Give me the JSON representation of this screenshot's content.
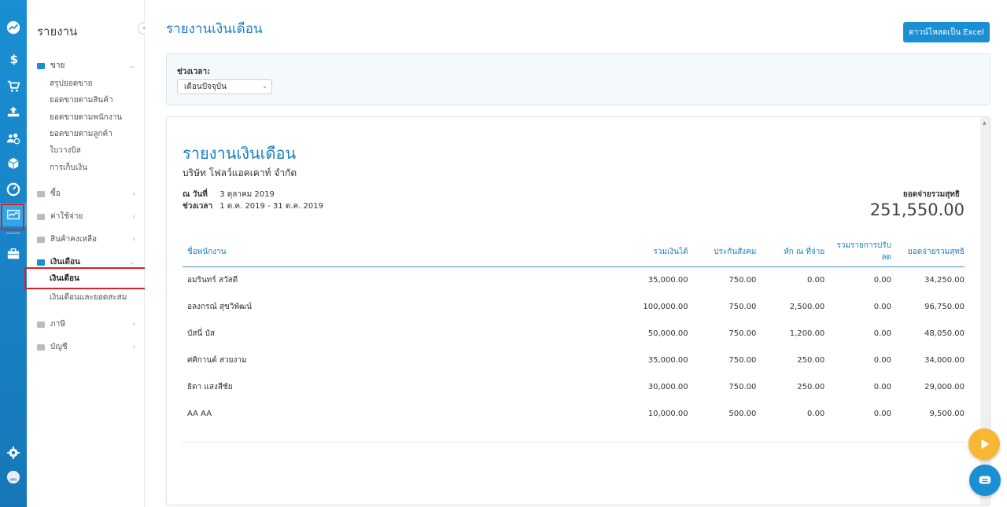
{
  "menu": {
    "title": "รายงาน",
    "groups": [
      {
        "label": "ขาย",
        "open": true,
        "items": [
          "สรุปยอดขาย",
          "ยอดขายตามสินค้า",
          "ยอดขายตามพนักงาน",
          "ยอดขายตามลูกค้า",
          "ใบวางบิล",
          "การเก็บเงิน"
        ]
      },
      {
        "label": "ซื้อ"
      },
      {
        "label": "ค่าใช้จ่าย"
      },
      {
        "label": "สินค้าคงเหลือ"
      },
      {
        "label": "เงินเดือน",
        "open": true,
        "items": [
          "เงินเดือน",
          "เงินเดือนและยอดสะสม"
        ]
      },
      {
        "label": "ภาษี"
      },
      {
        "label": "บัญชี"
      }
    ]
  },
  "page": {
    "title": "รายงานเงินเดือน",
    "excel_button": "ดาวน์โหลดเป็น Excel"
  },
  "filter": {
    "label": "ช่วงเวลา:",
    "selected": "เดือนปัจจุบัน"
  },
  "report": {
    "title": "รายงานเงินเดือน",
    "company": "บริษัท โฟลว์แอคเคาท์ จำกัด",
    "date_label": "ณ วันที่",
    "date_value": "3 ตุลาคม 2019",
    "period_label": "ช่วงเวลา",
    "period_value": "1 ต.ค. 2019 - 31 ต.ค. 2019",
    "net_label": "ยอดจ่ายรวมสุทธิ",
    "net_value": "251,550.00",
    "columns": [
      "ชื่อพนักงาน",
      "รวมเงินได้",
      "ประกันสังคม",
      "หัก ณ ที่จ่าย",
      "รวมรายการปรับลด",
      "ยอดจ่ายรวมสุทธิ"
    ],
    "rows": [
      [
        "อมรินทร์ สวัสดี",
        "35,000.00",
        "750.00",
        "0.00",
        "0.00",
        "34,250.00"
      ],
      [
        "อลงกรณ์ สุขวิพัฒน์",
        "100,000.00",
        "750.00",
        "2,500.00",
        "0.00",
        "96,750.00"
      ],
      [
        "บัสนี่ บัส",
        "50,000.00",
        "750.00",
        "1,200.00",
        "0.00",
        "48,050.00"
      ],
      [
        "ศศิกานต์ สวยงาม",
        "35,000.00",
        "750.00",
        "250.00",
        "0.00",
        "34,000.00"
      ],
      [
        "ธิดา แสงสีชัย",
        "30,000.00",
        "750.00",
        "250.00",
        "0.00",
        "29,000.00"
      ],
      [
        "AA AA",
        "10,000.00",
        "500.00",
        "0.00",
        "0.00",
        "9,500.00"
      ]
    ]
  },
  "colors": {
    "accent": "#1a8fd4",
    "title_blue": "#1a7fc2",
    "fab_play": "#f7b733",
    "highlight_red": "#e02020"
  },
  "icons": {
    "rail": [
      "analytics-icon",
      "dollar-icon",
      "cart-icon",
      "inbox-tray-icon",
      "people-icon",
      "box-icon",
      "gauge-icon",
      "report-chart-icon",
      "briefcase-icon",
      "gear-icon",
      "avatar-icon"
    ]
  }
}
